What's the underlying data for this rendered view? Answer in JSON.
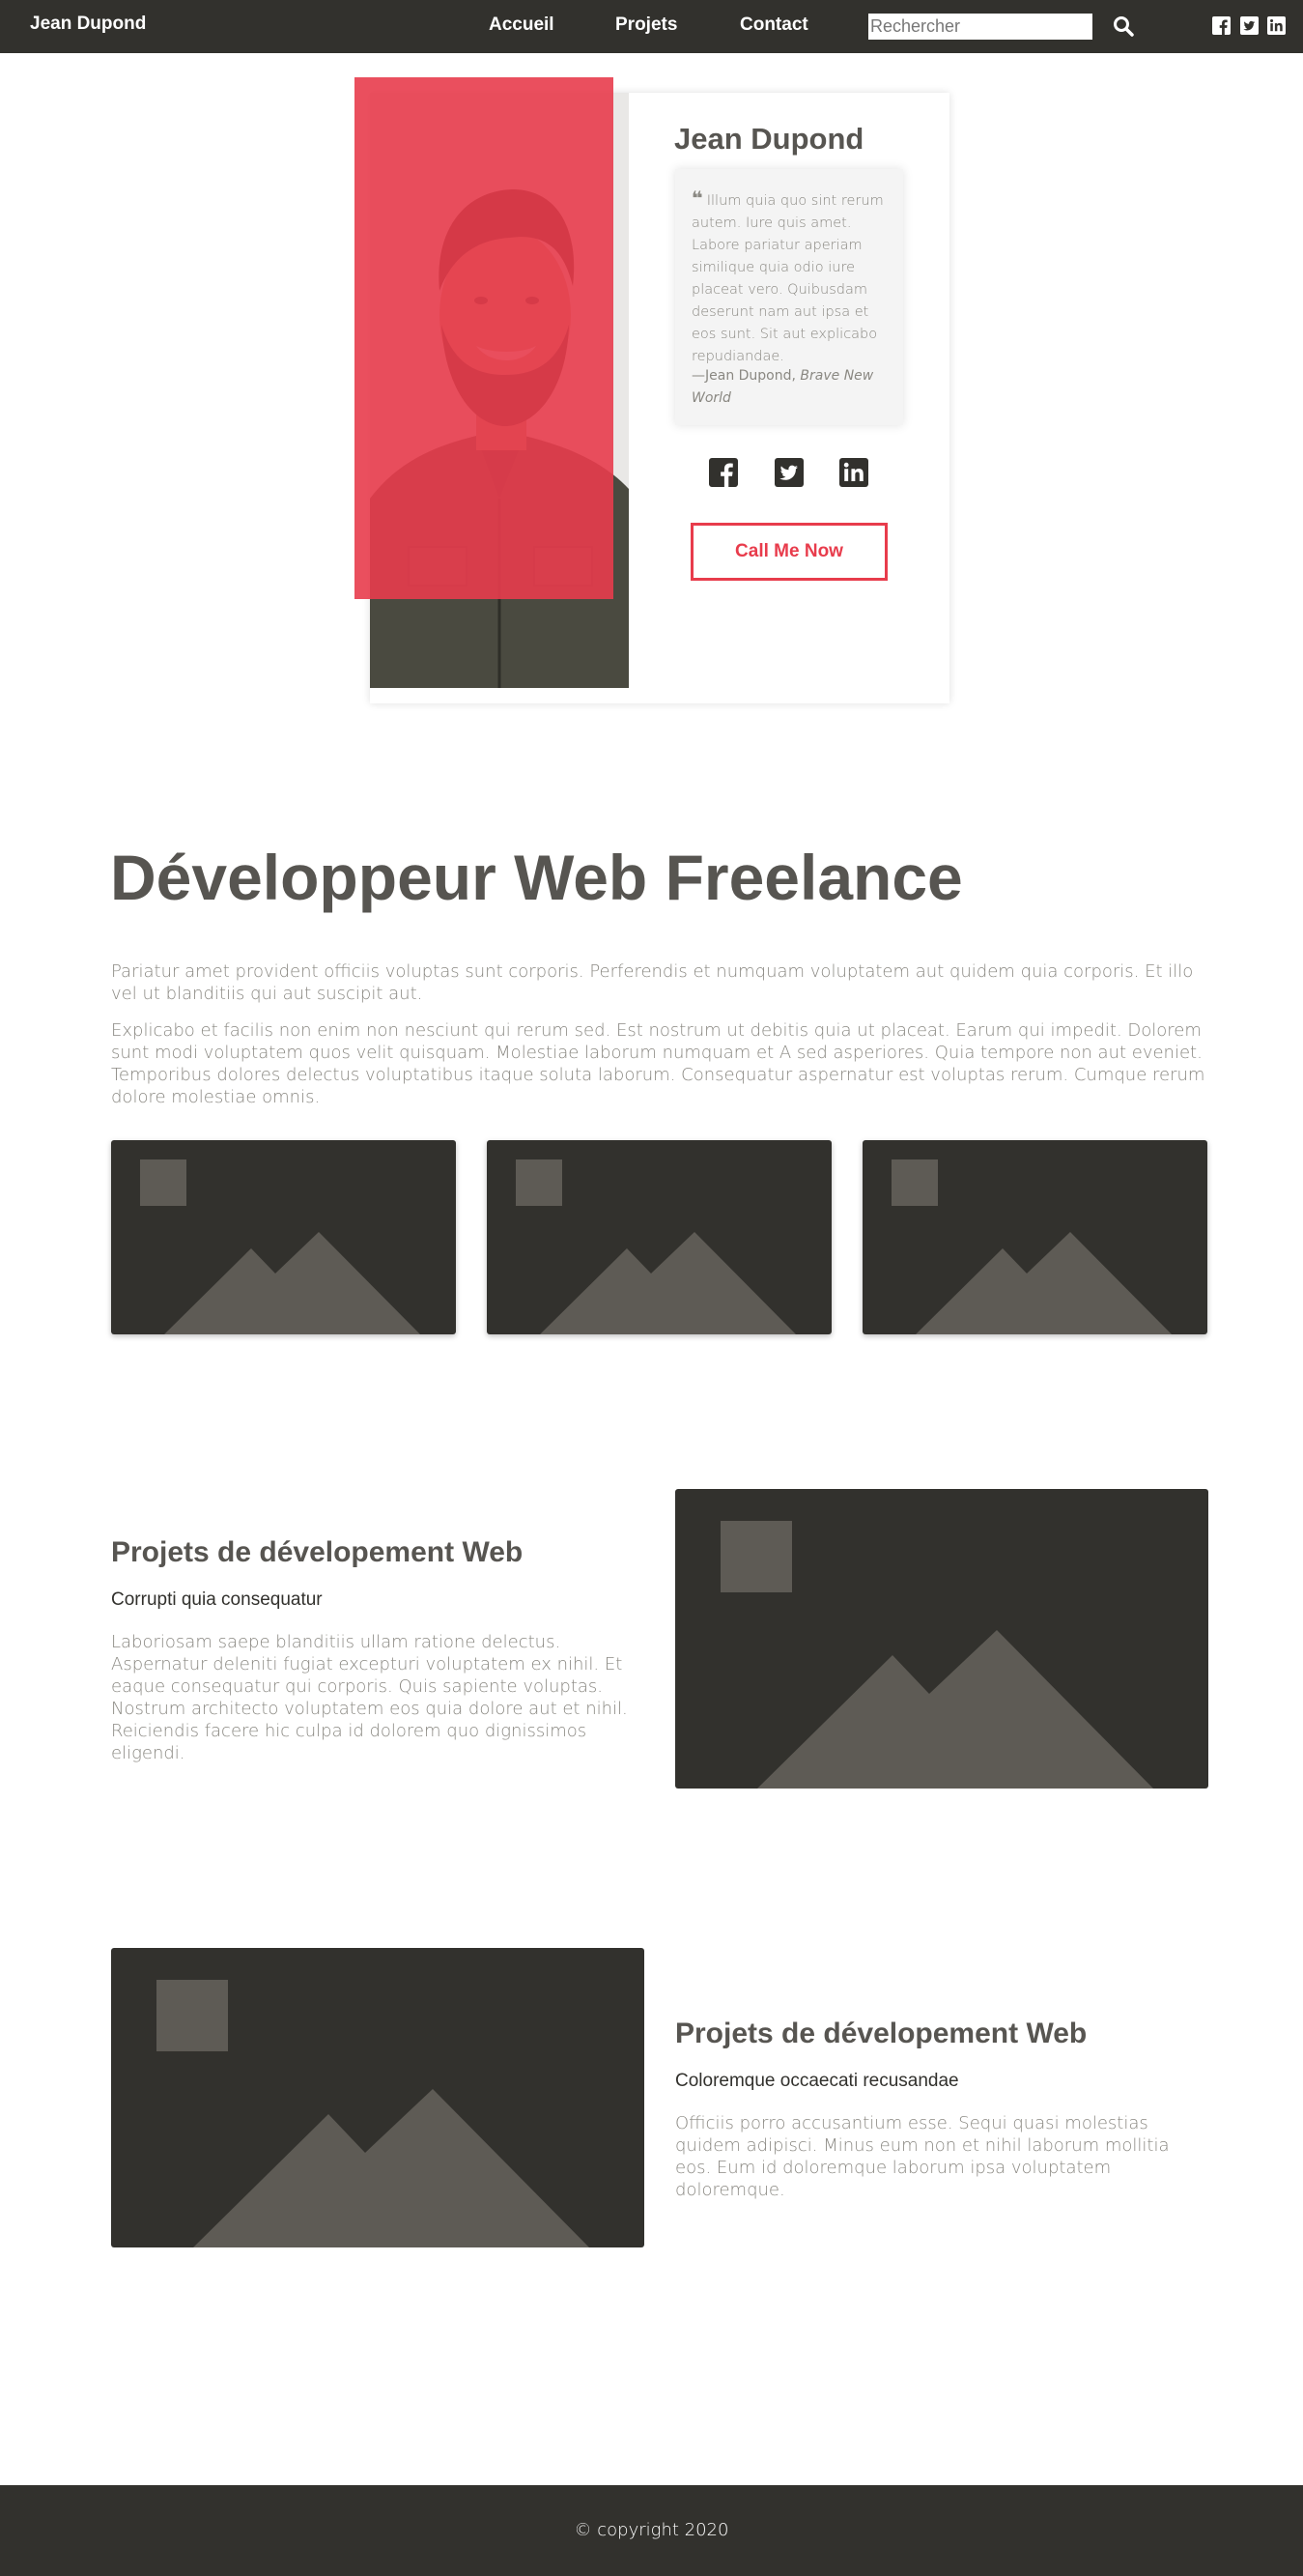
{
  "nav": {
    "brand": "Jean Dupond",
    "links": [
      "Accueil",
      "Projets",
      "Contact"
    ],
    "search_placeholder": "Rechercher",
    "icons": [
      "search-icon",
      "facebook-icon",
      "twitter-icon",
      "linkedin-icon"
    ]
  },
  "profile": {
    "name": "Jean Dupond",
    "quote": "Illum quia quo sint rerum autem. Iure quis amet. Labore pariatur aperiam similique quia odio iure placeat vero. Quibusdam deserunt nam aut ipsa et eos sunt. Sit aut explicabo repudiandae.",
    "quote_author": "—Jean Dupond,",
    "quote_source": "Brave New World",
    "social_icons": [
      "facebook-icon",
      "twitter-icon",
      "linkedin-icon"
    ],
    "cta_label": "Call Me Now"
  },
  "intro": {
    "title": "Développeur Web Freelance",
    "paragraphs": [
      "Pariatur amet provident officiis voluptas sunt corporis. Perferendis et numquam voluptatem aut quidem quia corporis. Et illo vel ut blanditiis qui aut suscipit aut.",
      "Explicabo et facilis non enim non nesciunt qui rerum sed. Est nostrum ut debitis quia ut placeat. Earum qui impedit. Dolorem sunt modi voluptatem quos velit quisquam. Molestiae laborum numquam et A sed asperiores. Quia tempore non aut eveniet. Temporibus dolores delectus voluptatibus itaque soluta laborum. Consequatur aspernatur est voluptas rerum. Cumque rerum dolore molestiae omnis."
    ]
  },
  "projects": [
    {
      "title": "Projets de dévelopement Web",
      "subtitle": "Corrupti quia consequatur",
      "text": "Laboriosam saepe blanditiis ullam ratione delectus. Aspernatur deleniti fugiat excepturi voluptatem ex nihil. Et eaque consequatur qui corporis. Quis sapiente voluptas. Nostrum architecto voluptatem eos quia dolore aut et nihil. Reiciendis facere hic culpa id dolorem quo dignissimos eligendi."
    },
    {
      "title": "Projets de dévelopement Web",
      "subtitle": "Coloremque occaecati recusandae",
      "text": "Officiis porro accusantium esse. Sequi quasi molestias quidem adipisci. Minus eum non et nihil laborum mollitia eos. Eum id doloremque laborum ipsa voluptatem doloremque."
    }
  ],
  "footer": {
    "copyright": "© copyright 2020"
  },
  "colors": {
    "dark": "#32312d",
    "accent": "#e83c4c",
    "text": "#575551",
    "muted": "#8a8882",
    "placeholder_shape": "#5e5b55"
  }
}
